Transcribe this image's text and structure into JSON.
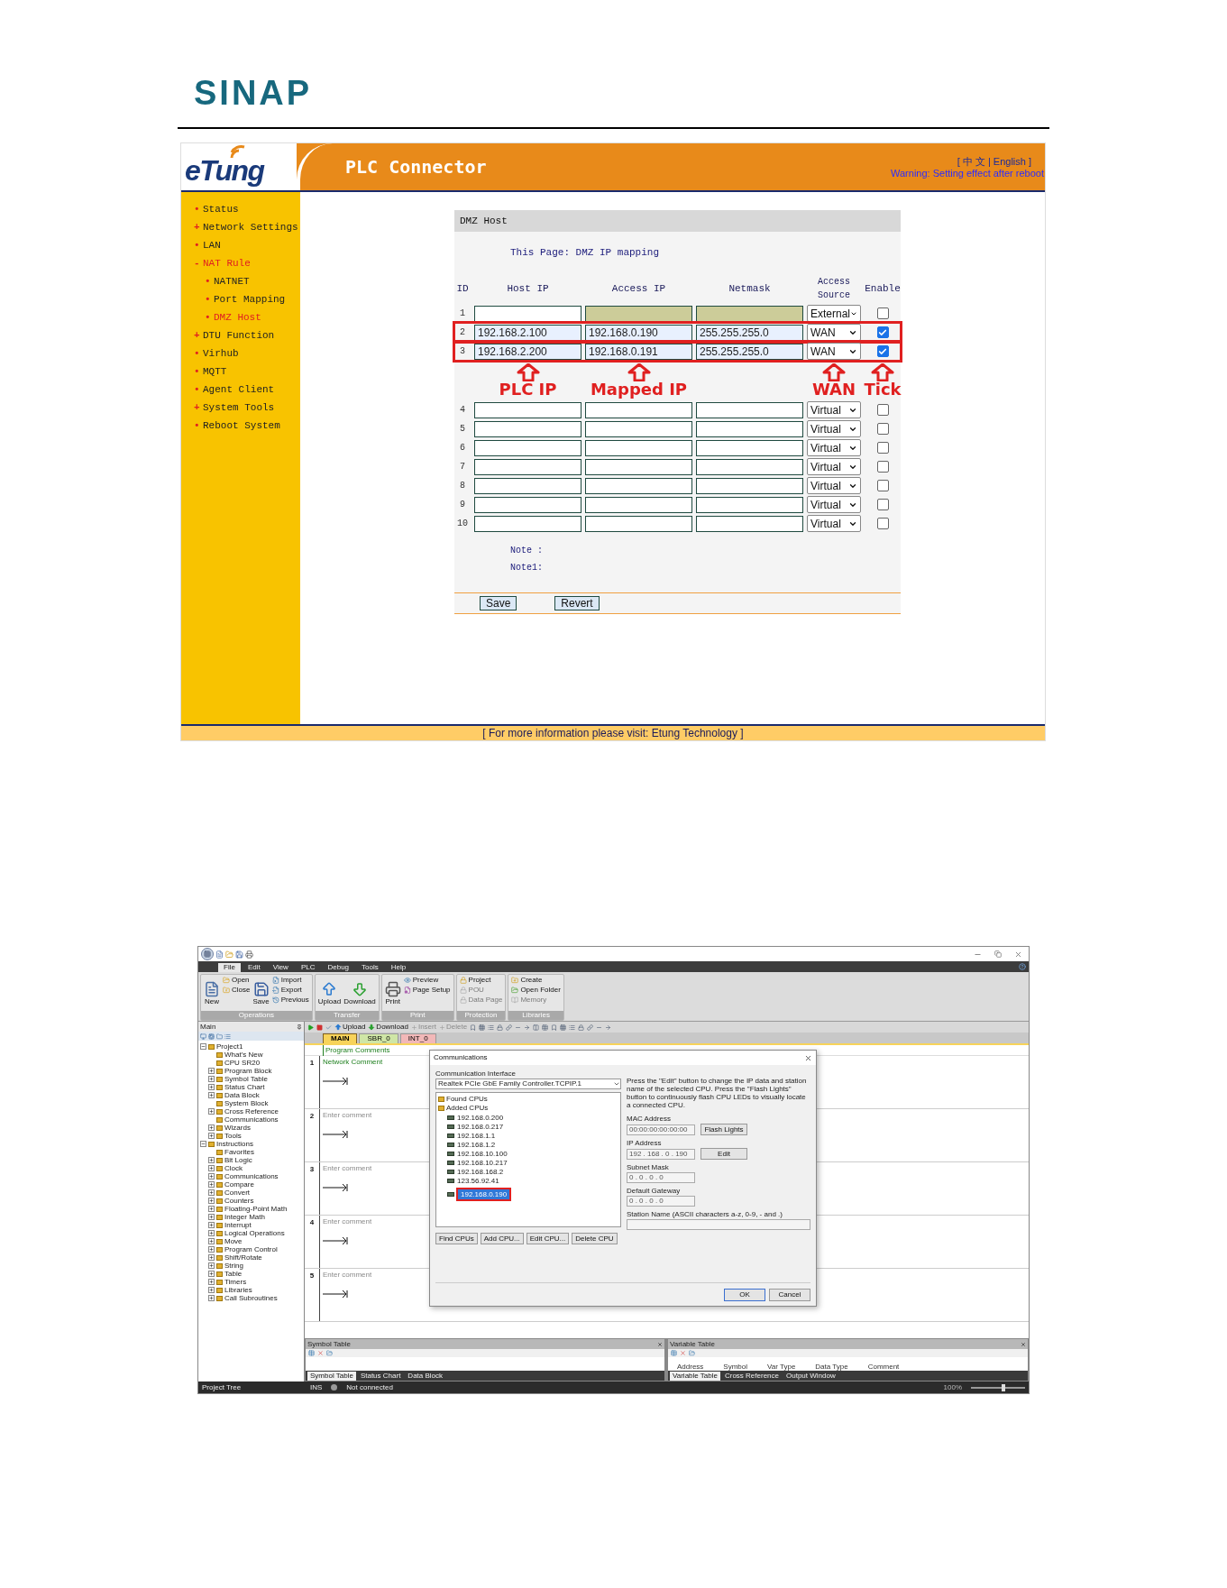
{
  "document": {
    "logo": "SINAP"
  },
  "router_page": {
    "brand": "eTung",
    "title": "PLC Connector",
    "language_bar": "[ 中 文 | English ]",
    "warning": "Warning: Setting effect after reboot",
    "nav": [
      {
        "bullet": "•",
        "label": "Status",
        "expanded": false
      },
      {
        "bullet": "+",
        "label": "Network Settings",
        "expanded": false
      },
      {
        "bullet": "•",
        "label": "LAN",
        "expanded": false
      },
      {
        "bullet": "-",
        "label": "NAT Rule",
        "expanded": true,
        "children": [
          {
            "bullet": "•",
            "label": "NATNET",
            "selected": false
          },
          {
            "bullet": "•",
            "label": "Port Mapping",
            "selected": false
          },
          {
            "bullet": "•",
            "label": "DMZ Host",
            "selected": true
          }
        ]
      },
      {
        "bullet": "+",
        "label": "DTU Function",
        "expanded": false
      },
      {
        "bullet": "•",
        "label": "Virhub",
        "expanded": false
      },
      {
        "bullet": "•",
        "label": "MQTT",
        "expanded": false
      },
      {
        "bullet": "•",
        "label": "Agent Client",
        "expanded": false
      },
      {
        "bullet": "+",
        "label": "System Tools",
        "expanded": false
      },
      {
        "bullet": "•",
        "label": "Reboot System",
        "expanded": false
      }
    ],
    "panel": {
      "title": "DMZ Host",
      "intro": "This Page: DMZ IP mapping",
      "columns": [
        "ID",
        "Host IP",
        "Access IP",
        "Netmask",
        "Access Source",
        "Enable"
      ],
      "rows": [
        {
          "id": "1",
          "source": "External",
          "enabled": false,
          "locked": true,
          "highlighted": false
        },
        {
          "id": "2",
          "host_ip": "192.168.2.100",
          "access_ip": "192.168.0.190",
          "netmask": "255.255.255.0",
          "source": "WAN",
          "enabled": true,
          "locked": false,
          "highlighted": true
        },
        {
          "id": "3",
          "host_ip": "192.168.2.200",
          "access_ip": "192.168.0.191",
          "netmask": "255.255.255.0",
          "source": "WAN",
          "enabled": true,
          "locked": false,
          "highlighted": true
        },
        {
          "id": "4",
          "source": "Virtual",
          "enabled": false,
          "locked": false,
          "highlighted": false
        },
        {
          "id": "5",
          "source": "Virtual",
          "enabled": false,
          "locked": false,
          "highlighted": false
        },
        {
          "id": "6",
          "source": "Virtual",
          "enabled": false,
          "locked": false,
          "highlighted": false
        },
        {
          "id": "7",
          "source": "Virtual",
          "enabled": false,
          "locked": false,
          "highlighted": false
        },
        {
          "id": "8",
          "source": "Virtual",
          "enabled": false,
          "locked": false,
          "highlighted": false
        },
        {
          "id": "9",
          "source": "Virtual",
          "enabled": false,
          "locked": false,
          "highlighted": false
        },
        {
          "id": "10",
          "source": "Virtual",
          "enabled": false,
          "locked": false,
          "highlighted": false
        }
      ],
      "notes": [
        "Note :",
        "Note1:"
      ],
      "buttons": [
        "Save",
        "Revert"
      ]
    },
    "annotations": [
      {
        "label": "PLC IP"
      },
      {
        "label": "Mapped IP"
      },
      {
        "label": "WAN"
      },
      {
        "label": "Tick"
      }
    ],
    "footer": "[ For more information please visit: Etung Technology ]"
  },
  "plc_software": {
    "menu_tabs": [
      {
        "label": "File",
        "selected": true
      },
      {
        "label": "Edit",
        "selected": false
      },
      {
        "label": "View",
        "selected": false
      },
      {
        "label": "PLC",
        "selected": false
      },
      {
        "label": "Debug",
        "selected": false
      },
      {
        "label": "Tools",
        "selected": false
      },
      {
        "label": "Help",
        "selected": false
      }
    ],
    "ribbon_groups": [
      {
        "label": "Operations",
        "items": [
          {
            "label": "New",
            "kind": "large",
            "disabled": false
          },
          {
            "label": "Open",
            "kind": "small",
            "disabled": false
          },
          {
            "label": "Close",
            "kind": "small",
            "disabled": false
          },
          {
            "label": "Save",
            "kind": "large",
            "disabled": false
          },
          {
            "label": "Import",
            "kind": "small",
            "disabled": false
          },
          {
            "label": "Export",
            "kind": "small",
            "disabled": false
          },
          {
            "label": "Previous",
            "kind": "small",
            "disabled": false
          }
        ]
      },
      {
        "label": "Transfer",
        "items": [
          {
            "label": "Upload",
            "kind": "large",
            "disabled": false
          },
          {
            "label": "Download",
            "kind": "large",
            "disabled": false
          }
        ]
      },
      {
        "label": "Print",
        "items": [
          {
            "label": "Print",
            "kind": "large",
            "disabled": false
          },
          {
            "label": "Preview",
            "kind": "small",
            "disabled": false
          },
          {
            "label": "Page Setup",
            "kind": "small",
            "disabled": false
          }
        ]
      },
      {
        "label": "Protection",
        "items": [
          {
            "label": "Project",
            "kind": "small",
            "disabled": false
          },
          {
            "label": "POU",
            "kind": "small",
            "disabled": true
          },
          {
            "label": "Data Page",
            "kind": "small",
            "disabled": true
          }
        ]
      },
      {
        "label": "Libraries",
        "items": [
          {
            "label": "Create",
            "kind": "small",
            "disabled": false
          },
          {
            "label": "Open Folder",
            "kind": "small",
            "disabled": false
          },
          {
            "label": "Memory",
            "kind": "small",
            "disabled": true
          }
        ]
      }
    ],
    "project_tree": {
      "title": "Main",
      "items": [
        {
          "label": "Project1",
          "expanded": true,
          "children": [
            {
              "label": "What's New"
            },
            {
              "label": "CPU SR20"
            },
            {
              "label": "Program Block",
              "expanded": false
            },
            {
              "label": "Symbol Table",
              "expanded": false
            },
            {
              "label": "Status Chart",
              "expanded": false
            },
            {
              "label": "Data Block",
              "expanded": false
            },
            {
              "label": "System Block"
            },
            {
              "label": "Cross Reference",
              "expanded": false
            },
            {
              "label": "Communications"
            },
            {
              "label": "Wizards",
              "expanded": false
            },
            {
              "label": "Tools",
              "expanded": false
            }
          ]
        },
        {
          "label": "Instructions",
          "expanded": true,
          "children": [
            {
              "label": "Favorites"
            },
            {
              "label": "Bit Logic",
              "expanded": false
            },
            {
              "label": "Clock",
              "expanded": false
            },
            {
              "label": "Communications",
              "expanded": false
            },
            {
              "label": "Compare",
              "expanded": false
            },
            {
              "label": "Convert",
              "expanded": false
            },
            {
              "label": "Counters",
              "expanded": false
            },
            {
              "label": "Floating-Point Math",
              "expanded": false
            },
            {
              "label": "Integer Math",
              "expanded": false
            },
            {
              "label": "Interrupt",
              "expanded": false
            },
            {
              "label": "Logical Operations",
              "expanded": false
            },
            {
              "label": "Move",
              "expanded": false
            },
            {
              "label": "Program Control",
              "expanded": false
            },
            {
              "label": "Shift/Rotate",
              "expanded": false
            },
            {
              "label": "String",
              "expanded": false
            },
            {
              "label": "Table",
              "expanded": false
            },
            {
              "label": "Timers",
              "expanded": false
            },
            {
              "label": "Libraries",
              "expanded": false
            },
            {
              "label": "Call Subroutines",
              "expanded": false
            }
          ]
        }
      ]
    },
    "editor_toolbar": [
      {
        "label": "Upload",
        "disabled": false
      },
      {
        "label": "Download",
        "disabled": false
      },
      {
        "label": "Insert",
        "disabled": true
      },
      {
        "label": "Delete",
        "disabled": true
      }
    ],
    "editor_tabs": [
      {
        "label": "MAIN",
        "selected": true,
        "color": "#f7d35a"
      },
      {
        "label": "SBR_0",
        "selected": false,
        "color": "#cfe6a6"
      },
      {
        "label": "INT_0",
        "selected": false,
        "color": "#f2b8b8"
      }
    ],
    "program_comments": "Program Comments",
    "networks": [
      {
        "number": "1",
        "comment": "Network Comment"
      },
      {
        "number": "2",
        "placeholder": "Enter comment"
      },
      {
        "number": "3",
        "placeholder": "Enter comment"
      },
      {
        "number": "4",
        "placeholder": "Enter comment"
      },
      {
        "number": "5",
        "placeholder": "Enter comment"
      }
    ],
    "dialog": {
      "title": "Communications",
      "interface_label": "Communication Interface",
      "interface": "Realtek PCIe GbE Family Controller.TCPIP.1",
      "help": "Press the \"Edit\" button to change the IP data and station name of the selected CPU. Press the \"Flash Lights\" button to continuously flash CPU LEDs to visually locate a connected CPU.",
      "tree": [
        {
          "label": "Found CPUs"
        },
        {
          "label": "Added CPUs",
          "children": [
            {
              "label": "192.168.0.200",
              "selected": false,
              "highlighted": false
            },
            {
              "label": "192.168.0.217",
              "selected": false,
              "highlighted": false
            },
            {
              "label": "192.168.1.1",
              "selected": false,
              "highlighted": false
            },
            {
              "label": "192.168.1.2",
              "selected": false,
              "highlighted": false
            },
            {
              "label": "192.168.10.100",
              "selected": false,
              "highlighted": false
            },
            {
              "label": "192.168.10.217",
              "selected": false,
              "highlighted": false
            },
            {
              "label": "192.168.168.2",
              "selected": false,
              "highlighted": false
            },
            {
              "label": "123.56.92.41",
              "selected": false,
              "highlighted": false
            },
            {
              "label": "192.168.0.190",
              "selected": true,
              "highlighted": true
            }
          ]
        }
      ],
      "fields": [
        {
          "label": "MAC Address",
          "value": "00:00:00:00:00:00",
          "button": "Flash Lights",
          "kind": "short"
        },
        {
          "label": "IP Address",
          "value": "192 . 168 . 0 . 190",
          "button": "Edit",
          "kind": "short"
        },
        {
          "label": "Subnet Mask",
          "value": "0 . 0 . 0 . 0",
          "kind": "short"
        },
        {
          "label": "Default Gateway",
          "value": "0 . 0 . 0 . 0",
          "kind": "short"
        },
        {
          "label": "Station Name (ASCII characters a-z, 0-9, - and .)",
          "kind": "wide"
        }
      ],
      "cpu_buttons": [
        "Find CPUs",
        "Add CPU...",
        "Edit CPU...",
        "Delete CPU"
      ],
      "buttons": [
        "OK",
        "Cancel"
      ]
    },
    "symbol_panel": {
      "title": "Symbol Table",
      "tabs": [
        {
          "label": "Symbol Table",
          "selected": true
        },
        {
          "label": "Status Chart",
          "selected": false
        },
        {
          "label": "Data Block",
          "selected": false
        }
      ]
    },
    "variable_panel": {
      "title": "Variable Table",
      "columns": [
        "Address",
        "Symbol",
        "Var Type",
        "Data Type",
        "Comment"
      ],
      "tabs": [
        {
          "label": "Variable Table",
          "selected": true
        },
        {
          "label": "Cross Reference",
          "selected": false
        },
        {
          "label": "Output Window",
          "selected": false
        }
      ]
    },
    "status_bar": {
      "panel": "Project Tree",
      "mode": "INS",
      "connection": "Not connected",
      "zoom": "100%",
      "level": 0.6
    }
  }
}
